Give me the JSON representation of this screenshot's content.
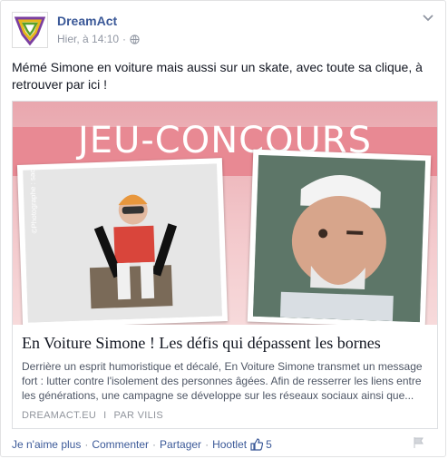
{
  "post": {
    "page_name": "DreamAct",
    "timestamp": "Hier, à 14:10",
    "separator": "·",
    "text": "Mémé Simone en voiture mais aussi sur un skate, avec toute sa clique, à retrouver par ici !"
  },
  "link": {
    "image_banner_text": "JEU-CONCOURS",
    "photo_credit": "©Photographe : sacha goldberger",
    "title": "En Voiture Simone ! Les défis qui dépassent les bornes",
    "description": "Derrière un esprit humoristique et décalé, En Voiture Simone transmet un message fort : lutter contre l'isolement des personnes âgées. Afin de resserrer les liens entre les générations, une campagne se développe sur les réseaux sociaux ainsi que...",
    "source_domain": "DREAMACT.EU",
    "source_sep": "I",
    "source_author": "PAR VILIS"
  },
  "actions": {
    "unlike": "Je n'aime plus",
    "comment": "Commenter",
    "share": "Partager",
    "hootlet": "Hootlet",
    "sep": "·",
    "like_count": "5"
  },
  "icons": {
    "globe": "globe-icon",
    "chevron": "chevron-down-icon",
    "like": "thumbs-up-icon",
    "flag": "flag-icon"
  },
  "colors": {
    "link": "#3b5998",
    "meta": "#9197a3",
    "banner": "#e88993"
  }
}
